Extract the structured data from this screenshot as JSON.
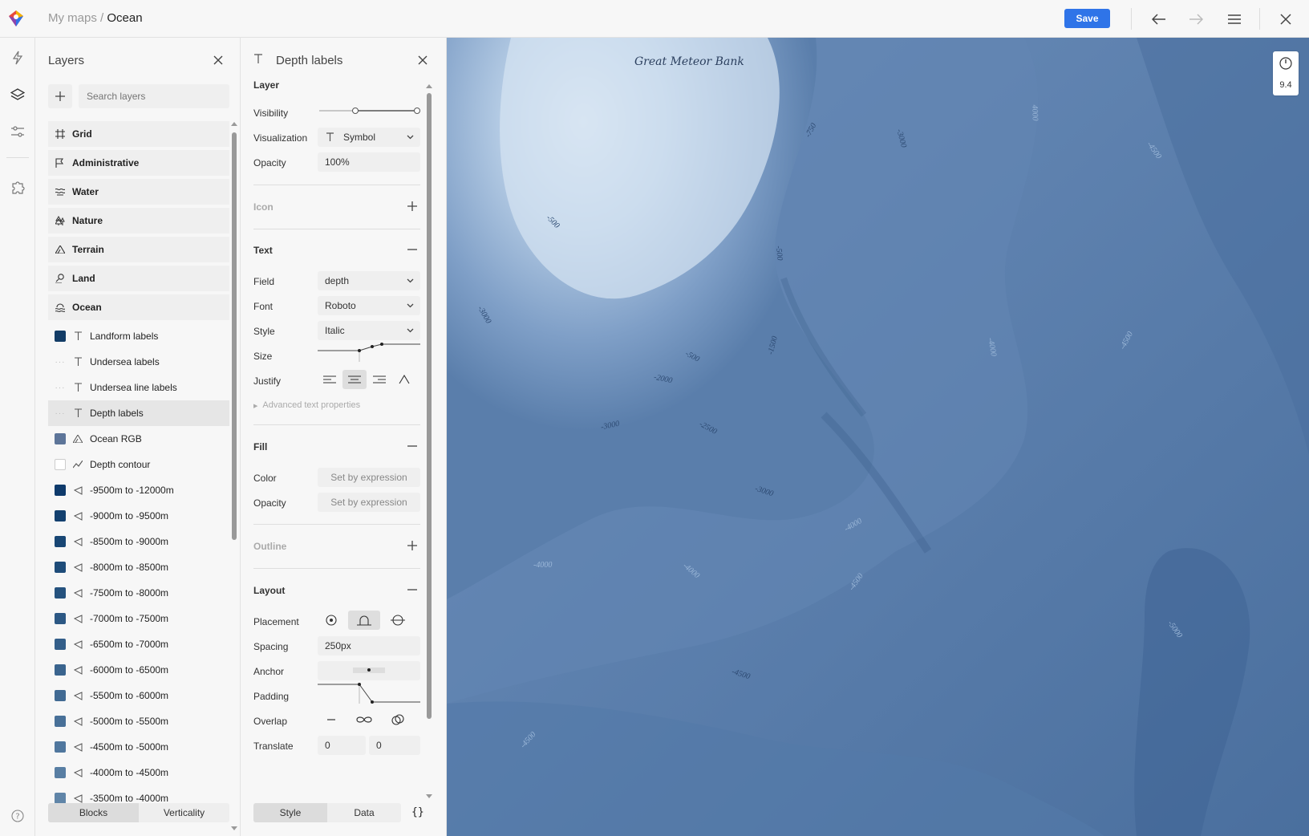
{
  "topbar": {
    "breadcrumb_root": "My maps",
    "breadcrumb_sep": "/",
    "breadcrumb_current": "Ocean",
    "save_label": "Save"
  },
  "layers_panel": {
    "title": "Layers",
    "search_placeholder": "Search layers",
    "groups": [
      {
        "label": "Grid",
        "icon": "grid-icon"
      },
      {
        "label": "Administrative",
        "icon": "flag-icon"
      },
      {
        "label": "Water",
        "icon": "waves-icon"
      },
      {
        "label": "Nature",
        "icon": "tree-icon"
      },
      {
        "label": "Terrain",
        "icon": "mountain-icon"
      },
      {
        "label": "Land",
        "icon": "pin-icon"
      },
      {
        "label": "Ocean",
        "icon": "ocean-icon"
      }
    ],
    "items": [
      {
        "label": "Landform labels",
        "swatch": "#123c66",
        "type": "text"
      },
      {
        "label": "Undersea labels",
        "swatch": "",
        "type": "text"
      },
      {
        "label": "Undersea line labels",
        "swatch": "",
        "type": "text"
      },
      {
        "label": "Depth labels",
        "swatch": "",
        "type": "text",
        "selected": true
      },
      {
        "label": "Ocean RGB",
        "swatch": "#5d7599",
        "type": "raster"
      },
      {
        "label": "Depth contour",
        "swatch": "#ffffff",
        "type": "line"
      },
      {
        "label": "-9500m to -12000m",
        "swatch": "#0e3a6b",
        "type": "fill"
      },
      {
        "label": "-9000m to -9500m",
        "swatch": "#13406f",
        "type": "fill"
      },
      {
        "label": "-8500m to -9000m",
        "swatch": "#184674",
        "type": "fill"
      },
      {
        "label": "-8000m to -8500m",
        "swatch": "#1e4c79",
        "type": "fill"
      },
      {
        "label": "-7500m to -8000m",
        "swatch": "#25527e",
        "type": "fill"
      },
      {
        "label": "-7000m to -7500m",
        "swatch": "#2c5884",
        "type": "fill"
      },
      {
        "label": "-6500m to -7000m",
        "swatch": "#335e89",
        "type": "fill"
      },
      {
        "label": "-6000m to -6500m",
        "swatch": "#3a648e",
        "type": "fill"
      },
      {
        "label": "-5500m to -6000m",
        "swatch": "#416a93",
        "type": "fill"
      },
      {
        "label": "-5000m to -5500m",
        "swatch": "#487098",
        "type": "fill"
      },
      {
        "label": "-4500m to -5000m",
        "swatch": "#50779e",
        "type": "fill"
      },
      {
        "label": "-4000m to -4500m",
        "swatch": "#587ea3",
        "type": "fill"
      },
      {
        "label": "-3500m to -4000m",
        "swatch": "#6085a8",
        "type": "fill"
      }
    ],
    "tabs": [
      "Blocks",
      "Verticality"
    ]
  },
  "props_panel": {
    "title": "Depth labels",
    "layer_section": "Layer",
    "visibility_label": "Visibility",
    "visualization_label": "Visualization",
    "visualization_value": "Symbol",
    "opacity_label": "Opacity",
    "opacity_value": "100%",
    "icon_section": "Icon",
    "text_section": "Text",
    "field_label": "Field",
    "field_value": "depth",
    "font_label": "Font",
    "font_value": "Roboto",
    "style_label": "Style",
    "style_value": "Italic",
    "size_label": "Size",
    "justify_label": "Justify",
    "advanced_label": "Advanced text properties",
    "fill_section": "Fill",
    "color_label": "Color",
    "color_value": "Set by expression",
    "fill_opacity_label": "Opacity",
    "fill_opacity_value": "Set by expression",
    "outline_section": "Outline",
    "layout_section": "Layout",
    "placement_label": "Placement",
    "spacing_label": "Spacing",
    "spacing_value": "250px",
    "anchor_label": "Anchor",
    "padding_label": "Padding",
    "overlap_label": "Overlap",
    "translate_label": "Translate",
    "translate_x": "0",
    "translate_y": "0",
    "tabs": [
      "Style",
      "Data"
    ],
    "code_label": "{}"
  },
  "map": {
    "title_label": "Great Meteor Bank",
    "zoom_value": "9.4",
    "depth_labels": [
      {
        "text": "-750",
        "rot": -62
      },
      {
        "text": "-3000",
        "rot": 75
      },
      {
        "text": "4000",
        "rot": 88
      },
      {
        "text": "-4500",
        "rot": 55
      },
      {
        "text": "-500",
        "rot": 45
      },
      {
        "text": "-500",
        "rot": 85
      },
      {
        "text": "-3000",
        "rot": 60
      },
      {
        "text": "-1500",
        "rot": -75
      },
      {
        "text": "-4000",
        "rot": 80
      },
      {
        "text": "-4500",
        "rot": -62
      },
      {
        "text": "-500",
        "rot": 28
      },
      {
        "text": "-2000",
        "rot": 12
      },
      {
        "text": "-3000",
        "rot": -12
      },
      {
        "text": "-2500",
        "rot": 28
      },
      {
        "text": "-3000",
        "rot": 18
      },
      {
        "text": "-4000",
        "rot": -30
      },
      {
        "text": "-4000",
        "rot": 0
      },
      {
        "text": "-4000",
        "rot": 40
      },
      {
        "text": "-4500",
        "rot": -55
      },
      {
        "text": "-5000",
        "rot": 55
      },
      {
        "text": "-4500",
        "rot": 18
      },
      {
        "text": "-4500",
        "rot": -48
      }
    ]
  },
  "colors": {
    "accent": "#2f74e8",
    "map_base": "#4f76a6",
    "map_bank": "#c9dcef"
  }
}
